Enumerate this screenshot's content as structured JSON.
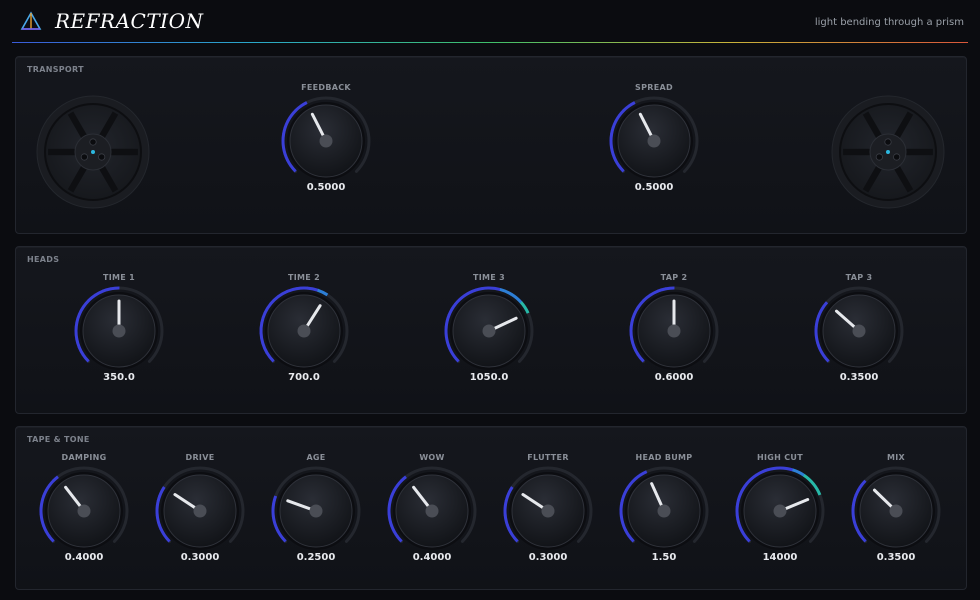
{
  "header": {
    "title": "REFRACTION",
    "tagline": "light bending through a prism"
  },
  "colors": {
    "arc_start": "#3a3fd8",
    "arc_mid": "#2d7fd6",
    "arc_teal": "#27b9a8",
    "arc_warm": "#e0a020",
    "accent": "#2cb8e0"
  },
  "sections": [
    {
      "id": "transport",
      "title": "TRANSPORT",
      "knobs": [
        {
          "id": "feedback",
          "label": "FEEDBACK",
          "value": "0.5000",
          "norm": 0.4
        },
        {
          "id": "spread",
          "label": "SPREAD",
          "value": "0.5000",
          "norm": 0.4
        }
      ]
    },
    {
      "id": "heads",
      "title": "HEADS",
      "knobs": [
        {
          "id": "time-1",
          "label": "TIME 1",
          "value": "350.0",
          "norm": 0.5
        },
        {
          "id": "time-2",
          "label": "TIME 2",
          "value": "700.0",
          "norm": 0.62
        },
        {
          "id": "time-3",
          "label": "TIME 3",
          "value": "1050.0",
          "norm": 0.74
        },
        {
          "id": "tap-2",
          "label": "TAP 2",
          "value": "0.6000",
          "norm": 0.5
        },
        {
          "id": "tap-3",
          "label": "TAP 3",
          "value": "0.3500",
          "norm": 0.32
        }
      ]
    },
    {
      "id": "tape-tone",
      "title": "TAPE & TONE",
      "knobs": [
        {
          "id": "damping",
          "label": "DAMPING",
          "value": "0.4000",
          "norm": 0.36
        },
        {
          "id": "drive",
          "label": "DRIVE",
          "value": "0.3000",
          "norm": 0.29
        },
        {
          "id": "age",
          "label": "AGE",
          "value": "0.2500",
          "norm": 0.24
        },
        {
          "id": "wow",
          "label": "WOW",
          "value": "0.4000",
          "norm": 0.36
        },
        {
          "id": "flutter",
          "label": "FLUTTER",
          "value": "0.3000",
          "norm": 0.29
        },
        {
          "id": "head-bump",
          "label": "HEAD BUMP",
          "value": "1.50",
          "norm": 0.41
        },
        {
          "id": "high-cut",
          "label": "HIGH CUT",
          "value": "14000",
          "norm": 0.75
        },
        {
          "id": "mix",
          "label": "MIX",
          "value": "0.3500",
          "norm": 0.33
        }
      ]
    }
  ]
}
